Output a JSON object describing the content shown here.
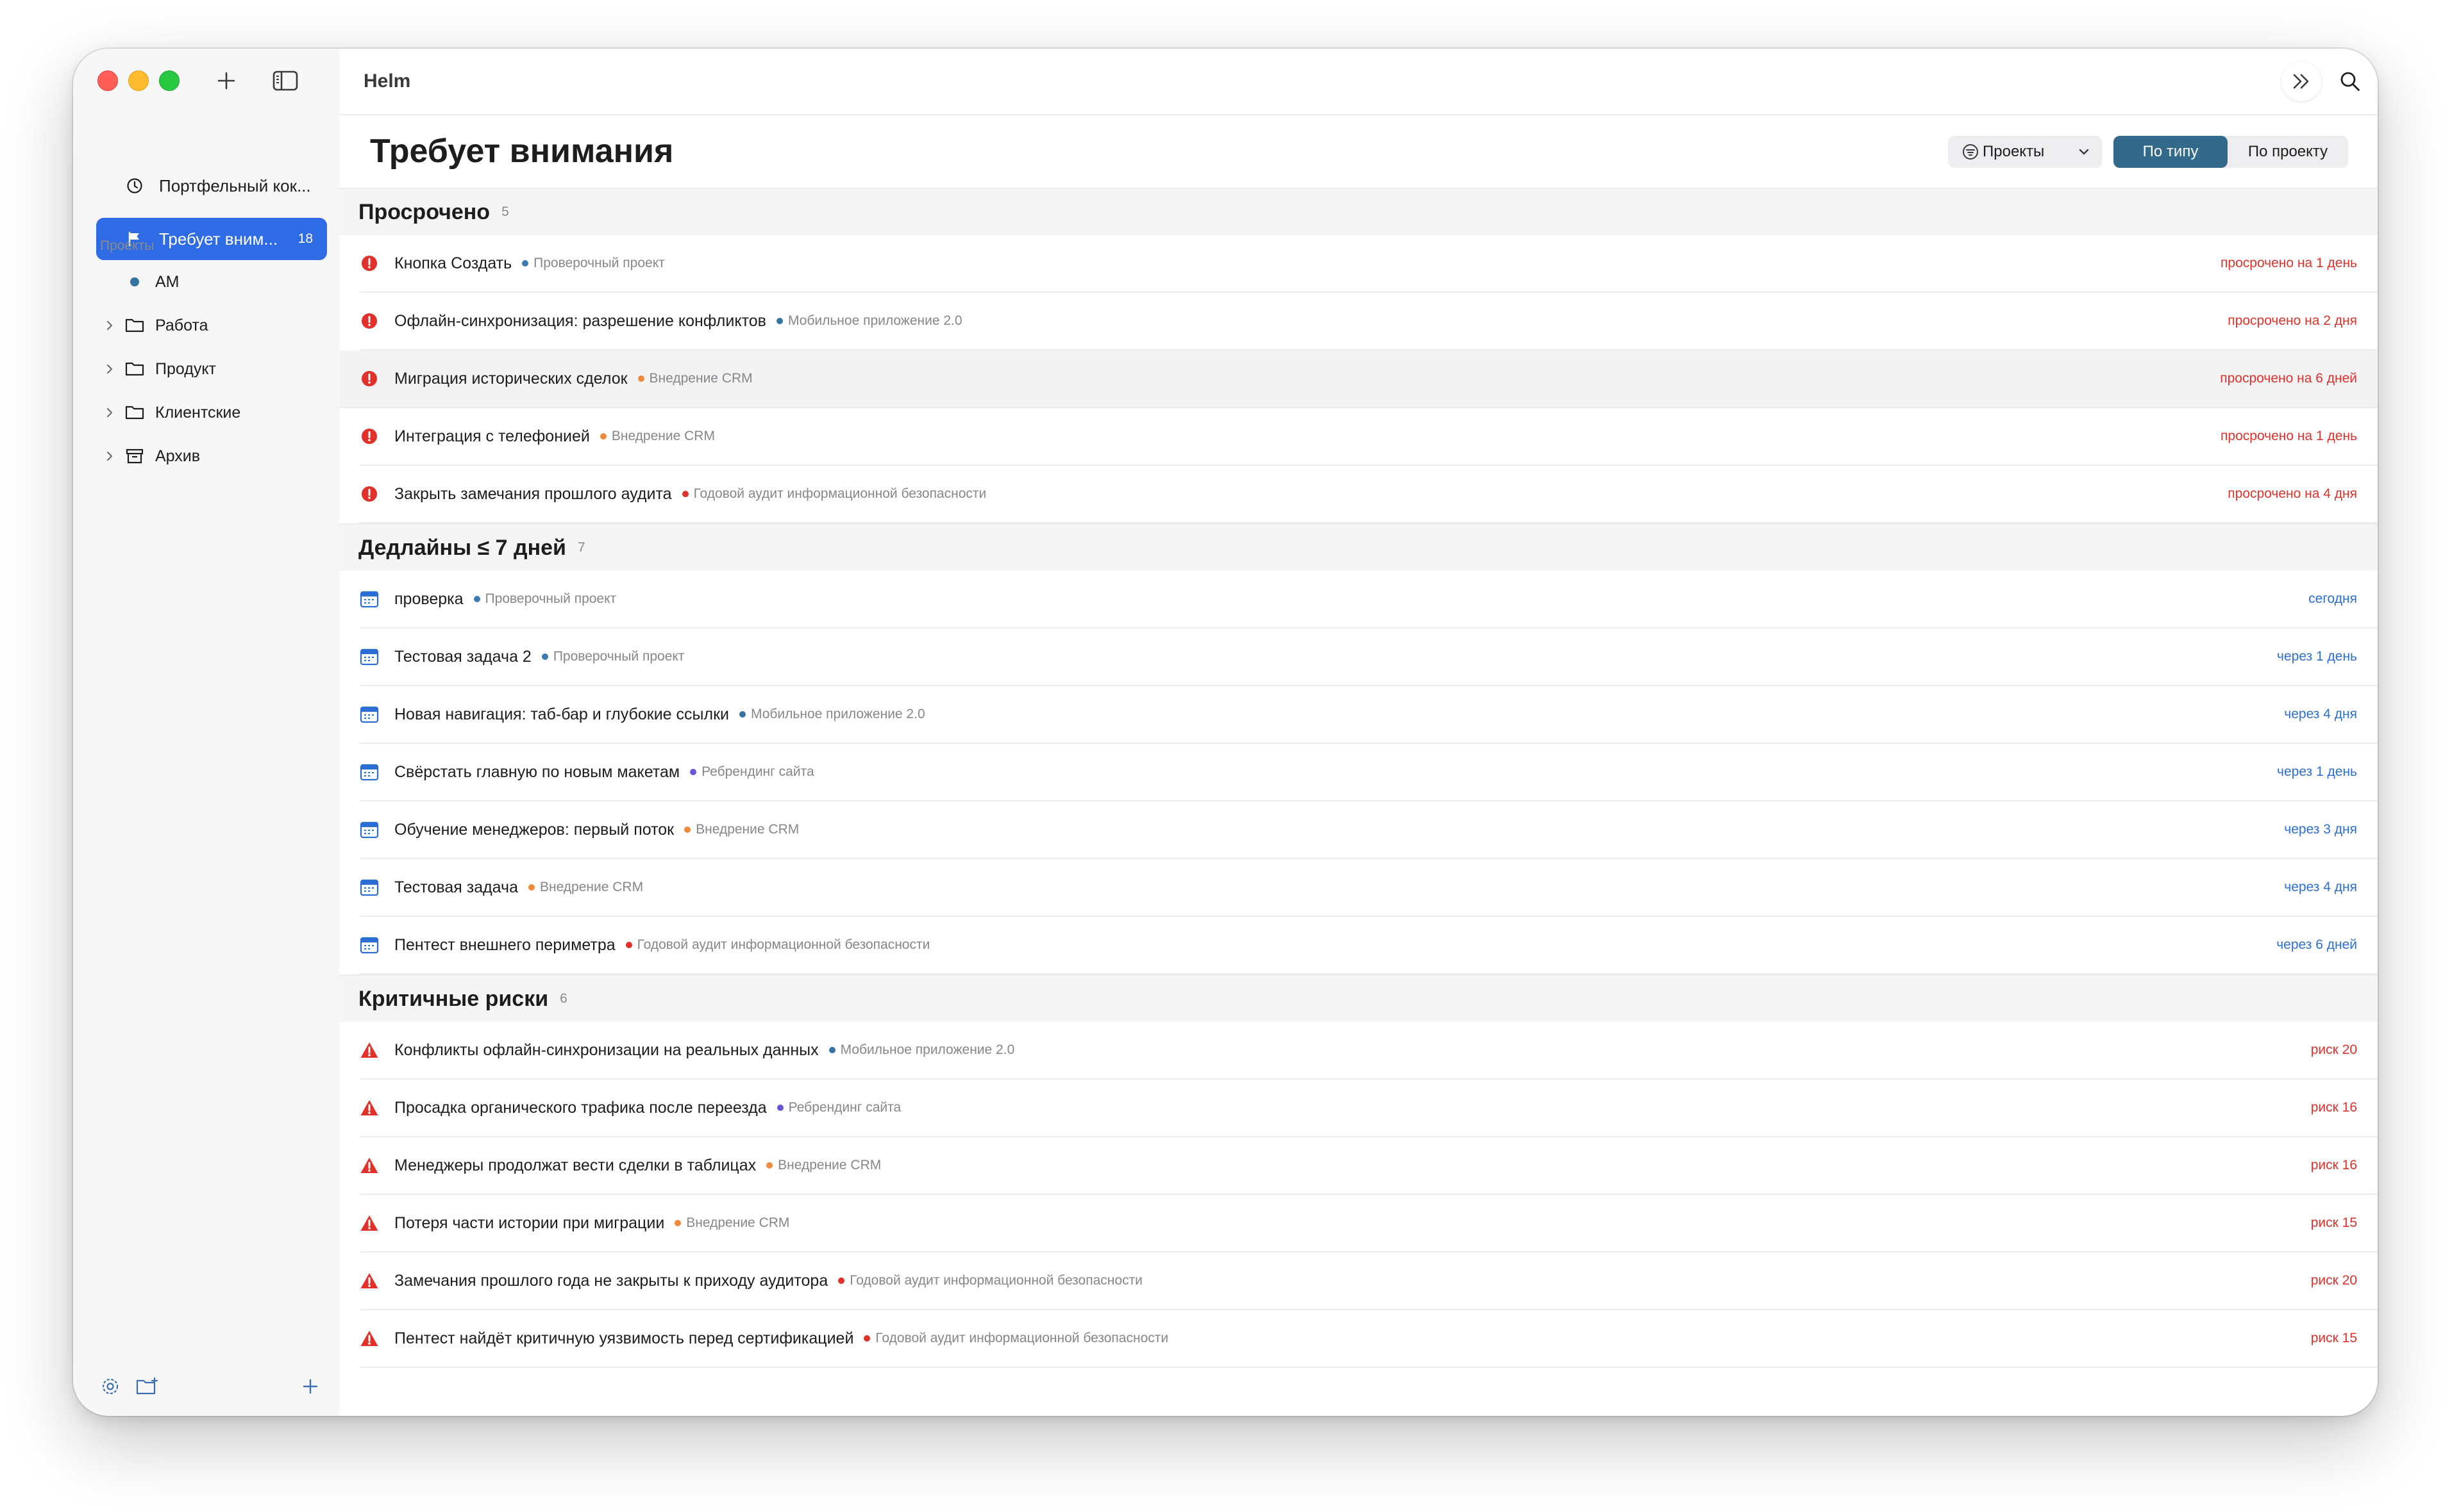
{
  "app": {
    "title": "Helm"
  },
  "colors": {
    "overdue": "#e0312b",
    "deadline": "#2b6fd6",
    "risk": "#e0312b",
    "accent": "#2e6be5",
    "segment_active": "#336a8c"
  },
  "sidebar": {
    "nav": [
      {
        "label": "Портфельный кок...",
        "icon": "clock-icon",
        "badge": "",
        "active": false
      },
      {
        "label": "Требует вним...",
        "icon": "flag-icon",
        "badge": "18",
        "active": true
      }
    ],
    "section_title": "Проекты",
    "projects": [
      {
        "label": "AM",
        "icon": "dot-icon",
        "has_chevron": false
      },
      {
        "label": "Работа",
        "icon": "folder-icon",
        "has_chevron": true
      },
      {
        "label": "Продукт",
        "icon": "folder-icon",
        "has_chevron": true
      },
      {
        "label": "Клиентские",
        "icon": "folder-icon",
        "has_chevron": true
      },
      {
        "label": "Архив",
        "icon": "archive-icon",
        "has_chevron": true
      }
    ]
  },
  "main": {
    "title": "Требует внимания",
    "filter": {
      "label": "Проекты"
    },
    "segments": [
      "По типу",
      "По проекту"
    ],
    "active_segment": 0
  },
  "groups": [
    {
      "title": "Просрочено",
      "count": "5",
      "kind": "overdue",
      "items": [
        {
          "title": "Кнопка Создать",
          "project": "Проверочный проект",
          "dot": "#3b7bb1",
          "status": "просрочено на 1 день",
          "highlight": false
        },
        {
          "title": "Офлайн-синхронизация: разрешение конфликтов",
          "project": "Мобильное приложение 2.0",
          "dot": "#35749e",
          "status": "просрочено на 2 дня",
          "highlight": false
        },
        {
          "title": "Миграция исторических сделок",
          "project": "Внедрение CRM",
          "dot": "#f08a3c",
          "status": "просрочено на 6 дней",
          "highlight": true
        },
        {
          "title": "Интеграция с телефонией",
          "project": "Внедрение CRM",
          "dot": "#f08a3c",
          "status": "просрочено на 1 день",
          "highlight": false
        },
        {
          "title": "Закрыть замечания прошлого аудита",
          "project": "Годовой аудит информационной безопасности",
          "dot": "#e0312b",
          "status": "просрочено на 4 дня",
          "highlight": false
        }
      ]
    },
    {
      "title": "Дедлайны ≤ 7 дней",
      "count": "7",
      "kind": "deadline",
      "items": [
        {
          "title": "проверка",
          "project": "Проверочный проект",
          "dot": "#3b7bb1",
          "status": "сегодня",
          "highlight": false
        },
        {
          "title": "Тестовая задача 2",
          "project": "Проверочный проект",
          "dot": "#3b7bb1",
          "status": "через 1 день",
          "highlight": false
        },
        {
          "title": "Новая навигация: таб-бар и глубокие ссылки",
          "project": "Мобильное приложение 2.0",
          "dot": "#35749e",
          "status": "через 4 дня",
          "highlight": false
        },
        {
          "title": "Свёрстать главную по новым макетам",
          "project": "Ребрендинг сайта",
          "dot": "#6b55d6",
          "status": "через 1 день",
          "highlight": false
        },
        {
          "title": "Обучение менеджеров: первый поток",
          "project": "Внедрение CRM",
          "dot": "#f08a3c",
          "status": "через 3 дня",
          "highlight": false
        },
        {
          "title": "Тестовая задача",
          "project": "Внедрение CRM",
          "dot": "#f08a3c",
          "status": "через 4 дня",
          "highlight": false
        },
        {
          "title": "Пентест внешнего периметра",
          "project": "Годовой аудит информационной безопасности",
          "dot": "#e0312b",
          "status": "через 6 дней",
          "highlight": false
        }
      ]
    },
    {
      "title": "Критичные риски",
      "count": "6",
      "kind": "risk",
      "items": [
        {
          "title": "Конфликты офлайн-синхронизации на реальных данных",
          "project": "Мобильное приложение 2.0",
          "dot": "#35749e",
          "status": "риск 20",
          "highlight": false
        },
        {
          "title": "Просадка органического трафика после переезда",
          "project": "Ребрендинг сайта",
          "dot": "#6b55d6",
          "status": "риск 16",
          "highlight": false
        },
        {
          "title": "Менеджеры продолжат вести сделки в таблицах",
          "project": "Внедрение CRM",
          "dot": "#f08a3c",
          "status": "риск 16",
          "highlight": false
        },
        {
          "title": "Потеря части истории при миграции",
          "project": "Внедрение CRM",
          "dot": "#f08a3c",
          "status": "риск 15",
          "highlight": false
        },
        {
          "title": "Замечания прошлого года не закрыты к приходу аудитора",
          "project": "Годовой аудит информационной безопасности",
          "dot": "#e0312b",
          "status": "риск 20",
          "highlight": false
        },
        {
          "title": "Пентест найдёт критичную уязвимость перед сертификацией",
          "project": "Годовой аудит информационной безопасности",
          "dot": "#e0312b",
          "status": "риск 15",
          "highlight": false
        }
      ]
    }
  ]
}
